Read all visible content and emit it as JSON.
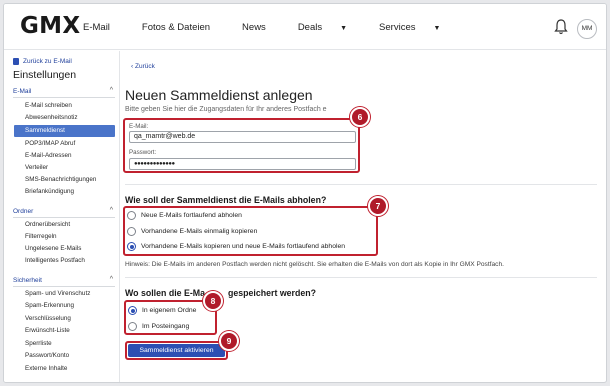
{
  "header": {
    "logo": "GMX",
    "nav": [
      {
        "label": "E-Mail",
        "has_caret": false
      },
      {
        "label": "Fotos & Dateien",
        "has_caret": false
      },
      {
        "label": "News",
        "has_caret": false
      },
      {
        "label": "Deals",
        "has_caret": true
      },
      {
        "label": "Services",
        "has_caret": true
      }
    ],
    "avatar_initials": "MM"
  },
  "sidebar": {
    "back_label": "Zurück zu E-Mail",
    "title": "Einstellungen",
    "sections": [
      {
        "label": "E-Mail",
        "items": [
          "E-Mail schreiben",
          "Abwesenheitsnotiz",
          "Sammeldienst",
          "POP3/IMAP Abruf",
          "E-Mail-Adressen",
          "Verteiler",
          "SMS-Benachrichtigungen",
          "Briefankündigung"
        ]
      },
      {
        "label": "Ordner",
        "items": [
          "Ordnerübersicht",
          "Filterregeln",
          "Ungelesene E-Mails",
          "Intelligentes Postfach"
        ]
      },
      {
        "label": "Sicherheit",
        "items": [
          "Spam- und Virenschutz",
          "Spam-Erkennung",
          "Verschlüsselung",
          "Erwünscht-Liste",
          "Sperrliste",
          "Passwort/Konto",
          "Externe Inhalte"
        ]
      }
    ],
    "active_item": "Sammeldienst"
  },
  "main": {
    "back_label": "Zurück",
    "title": "Neuen Sammeldienst anlegen",
    "subtitle": "Bitte geben Sie hier die Zugangsdaten für Ihr anderes Postfach e",
    "email_label": "E-Mail:",
    "email_value": "qa_mamtr@web.de",
    "password_label": "Passwort:",
    "password_value": "●●●●●●●●●●●●●",
    "fetch_heading": "Wie soll der Sammeldienst die E-Mails abholen?",
    "fetch_options": [
      {
        "label": "Neue E-Mails fortlaufend abholen",
        "selected": false
      },
      {
        "label": "Vorhandene E-Mails einmalig kopieren",
        "selected": false
      },
      {
        "label": "Vorhandene E-Mails kopieren und neue E-Mails fortlaufend abholen",
        "selected": true
      }
    ],
    "hint": "Hinweis: Die E-Mails im anderen Postfach werden nicht gelöscht. Sie erhalten die E-Mails von dort als Kopie in Ihr GMX Postfach.",
    "store_heading": "Wo sollen die E-Ma",
    "store_heading_end": "gespeichert werden?",
    "store_options": [
      {
        "label": "In eigenem Ordne",
        "selected": true
      },
      {
        "label": "Im Posteingang",
        "selected": false
      }
    ],
    "submit_label": "Sammeldienst aktivieren"
  },
  "badges": [
    "6",
    "7",
    "8",
    "9"
  ],
  "colors": {
    "accent": "#2c4fb3",
    "highlight": "#c0212f",
    "active_item": "#4a74c9"
  }
}
